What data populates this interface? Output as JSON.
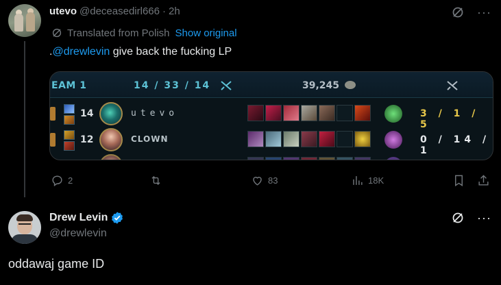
{
  "tweet1": {
    "display_name": "utevo",
    "handle": "@deceasedirl666",
    "separator": "·",
    "time": "2h",
    "translated_label": "Translated from Polish",
    "show_original": "Show original",
    "text_prefix": ".",
    "mention": "@drewlevin",
    "text_rest": " give back the fucking LP",
    "more": "···",
    "card": {
      "team_label": "EAM 1",
      "team_kda": "14 / 33 / 14",
      "team_gold": "39,245",
      "players": [
        {
          "level": "14",
          "name": "utevo",
          "kda": "3 / 1 / 5"
        },
        {
          "level": "12",
          "name": "CLOWN",
          "kda": "0 / 14 / 1"
        }
      ]
    },
    "actions": {
      "replies": "2",
      "retweets": "",
      "likes": "83",
      "views": "18K"
    }
  },
  "tweet2": {
    "display_name": "Drew Levin",
    "handle": "@drewlevin",
    "text": "oddawaj game ID",
    "more": "···"
  },
  "colors": {
    "background": "#000000",
    "text": "#e7e9ea",
    "muted": "#71767b",
    "link": "#1d9bf0",
    "verified": "#1d9bf0",
    "kda_gold": "#e8c84a",
    "team_blue": "#5dc2d6"
  },
  "icons": [
    "grok-icon",
    "more-icon",
    "translate-icon",
    "reply-icon",
    "retweet-icon",
    "like-icon",
    "views-icon",
    "bookmark-icon",
    "share-icon",
    "verified-icon"
  ]
}
